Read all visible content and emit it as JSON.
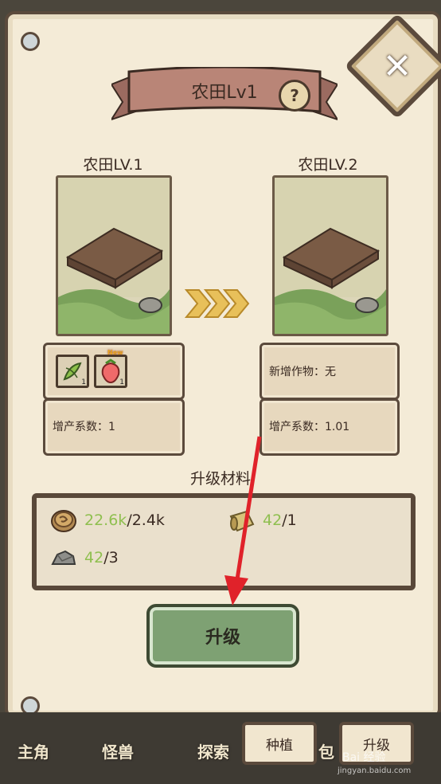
{
  "dialog": {
    "title": "农田Lv1",
    "help_label": "?",
    "close_label": "✕"
  },
  "current": {
    "level_label": "农田LV.1",
    "yield_text": "增产系数：1",
    "items": [
      {
        "icon": "green-bean-icon",
        "count": "1",
        "badge": ""
      },
      {
        "icon": "strawberry-icon",
        "count": "1",
        "badge": "New"
      }
    ]
  },
  "next": {
    "level_label": "农田LV.2",
    "new_crops_text": "新增作物：无",
    "yield_text": "增产系数：1.01"
  },
  "materials": {
    "title": "升级材料",
    "list": [
      {
        "icon": "coin-icon",
        "have": "22.6k",
        "need": "/2.4k"
      },
      {
        "icon": "wood-icon",
        "have": "42",
        "need": "/1"
      },
      {
        "icon": "stone-icon",
        "have": "42",
        "need": "/3"
      }
    ]
  },
  "upgrade_button": "升级",
  "bottom_nav": [
    "主角",
    "怪兽",
    "探索",
    "包"
  ],
  "tabs": [
    "种植",
    "升级"
  ],
  "watermark": {
    "brand": "Bai 经验",
    "url": "jingyan.baidu.com"
  },
  "colors": {
    "accent_green": "#8fbf4f",
    "button_green": "#7ea173",
    "ribbon": "#b98577",
    "annotation_arrow": "#e0222a"
  }
}
